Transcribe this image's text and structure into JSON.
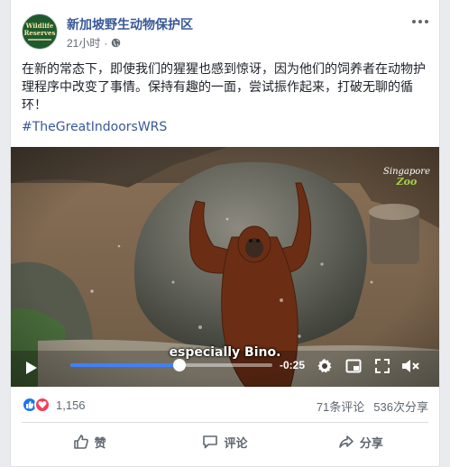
{
  "post": {
    "page_name": "新加坡野生动物保护区",
    "timestamp": "21小时",
    "separator": "·",
    "text": "在新的常态下，即使我们的猩猩也感到惊讶，因为他们的饲养者在动物护理程序中改变了事情。保持有趣的一面，尝试振作起来，打破无聊的循环！",
    "hashtag": "#TheGreatIndoorsWRS",
    "avatar_text": [
      "Wildlife",
      "Reserves"
    ]
  },
  "video": {
    "subtitle": "especially Bino.",
    "time_remaining": "-0:25",
    "progress": 0.54,
    "watermark_line1": "Singapore",
    "watermark_line2": "Zoo"
  },
  "stats": {
    "reaction_count": "1,156",
    "comments": "71条评论",
    "shares": "536次分享"
  },
  "actions": {
    "like": "赞",
    "comment": "评论",
    "share": "分享"
  },
  "colors": {
    "link": "#385898",
    "like_blue": "#1877f2",
    "love_red": "#f33e58",
    "seek": "#4080ff"
  }
}
